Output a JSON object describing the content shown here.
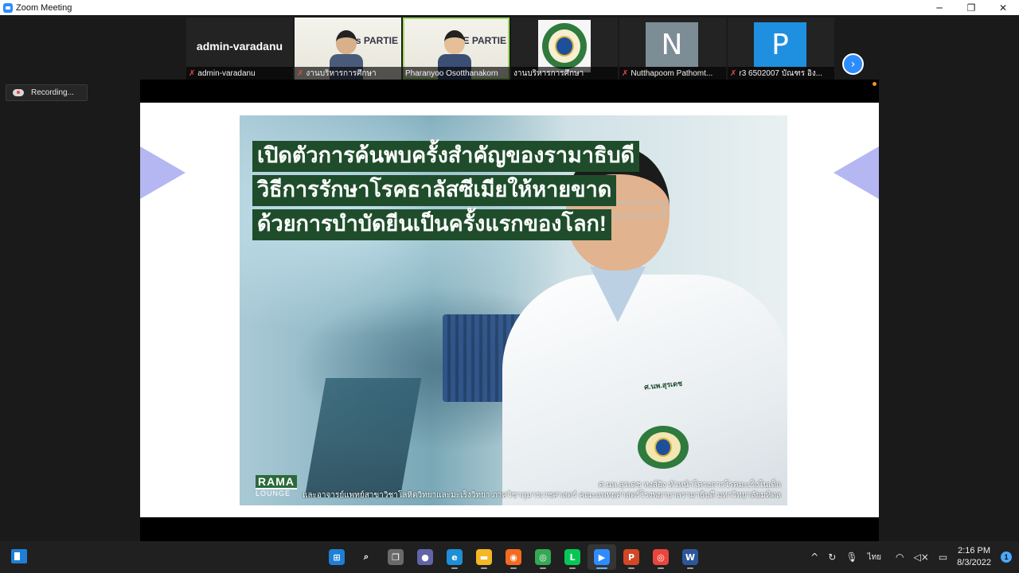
{
  "window": {
    "title": "Zoom Meeting",
    "minimize_glyph": "─",
    "restore_glyph": "❐",
    "close_glyph": "✕"
  },
  "participants": [
    {
      "name": "admin-varadanu",
      "display": "admin-varadanu",
      "muted": true,
      "type": "name"
    },
    {
      "name": "งานบริหารการศึกษา",
      "muted": true,
      "type": "video",
      "poster_text": "'s PARTIE"
    },
    {
      "name": "Pharanyoo Osotthanakorn",
      "muted": false,
      "type": "video",
      "active": true,
      "poster_text": "DE PARTIE"
    },
    {
      "name": "งานบริหารการศึกษา",
      "muted": false,
      "type": "logo"
    },
    {
      "name": "Nutthapoom Pathomt...",
      "muted": true,
      "type": "avatar",
      "initial": "N",
      "color": "#7d8d96"
    },
    {
      "name": "r3 6502007 บัณฑร อิง...",
      "muted": true,
      "type": "avatar",
      "initial": "P",
      "color": "#1f8fe0"
    }
  ],
  "next_arrow": "›",
  "recording": {
    "label": "Recording..."
  },
  "slide": {
    "headline": [
      "เปิดตัวการค้นพบครั้งสำคัญของรามาธิบดี",
      "วิธีการรักษาโรคธาลัสซีเมียให้หายขาด",
      "ด้วยการบำบัดยีนเป็นครั้งแรกของโลก!"
    ],
    "badge_tag": "ศ.นพ.สุรเดช",
    "brand_top": "RAMA",
    "brand_bottom": "LOUNGE",
    "caption_line1": "ศ.นพ.สุรเดช หงส์อิง หัวหน้าโครงการโรคมะเร็งในเด็ก",
    "caption_line2": "และอาจารย์แพทย์สาขาวิชาโลหิตวิทยาและมะเร็งวิทยา ภาควิชากุมารเวชศาสตร์ คณะแพทยศาสตร์โรงพยาบาลรามาธิบดี มหาวิทยาลัยมหิดล"
  },
  "taskbar": {
    "apps": [
      {
        "name": "windows-start",
        "glyph": "⊞",
        "color": "#1f7fd6"
      },
      {
        "name": "search",
        "glyph": "⌕",
        "color": "transparent"
      },
      {
        "name": "task-view",
        "glyph": "❐",
        "color": "#6a6a6a"
      },
      {
        "name": "teams-chat",
        "glyph": "●",
        "color": "#6264a7"
      },
      {
        "name": "edge",
        "glyph": "e",
        "color": "#1d8fd6"
      },
      {
        "name": "file-explorer",
        "glyph": "▬",
        "color": "#f3b822"
      },
      {
        "name": "firefox",
        "glyph": "◉",
        "color": "#f46a1f"
      },
      {
        "name": "chrome-profile",
        "glyph": "◎",
        "color": "#34a853"
      },
      {
        "name": "line",
        "glyph": "L",
        "color": "#06c755"
      },
      {
        "name": "zoom",
        "glyph": "▶",
        "color": "#2d8cff",
        "active": true
      },
      {
        "name": "powerpoint",
        "glyph": "P",
        "color": "#d24726"
      },
      {
        "name": "chrome",
        "glyph": "◎",
        "color": "#e8453c"
      },
      {
        "name": "word",
        "glyph": "W",
        "color": "#2b579a"
      }
    ],
    "tray_chevron": "^",
    "language": "ไทย",
    "time": "2:16 PM",
    "date": "8/3/2022",
    "notifications": "1"
  }
}
